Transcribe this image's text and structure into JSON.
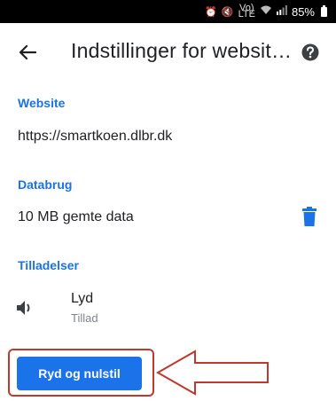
{
  "status_bar": {
    "network_label": "Vo)\nLTE",
    "battery_percent": "85%"
  },
  "app_bar": {
    "title": "Indstillinger for websit…",
    "back_icon": "arrow-back-icon",
    "help_icon": "help-circle-icon"
  },
  "website": {
    "label": "Website",
    "url": "https://smartkoen.dlbr.dk"
  },
  "data_usage": {
    "label": "Databrug",
    "value": "10 MB gemte data",
    "delete_icon": "trash-icon"
  },
  "permissions": {
    "label": "Tilladelser",
    "items": [
      {
        "name": "Lyd",
        "value": "Tillad",
        "icon": "volume-icon"
      }
    ]
  },
  "reset_button": {
    "label": "Ryd og nulstil"
  },
  "colors": {
    "accent": "#1a73e8",
    "annotation": "#c0392b"
  }
}
